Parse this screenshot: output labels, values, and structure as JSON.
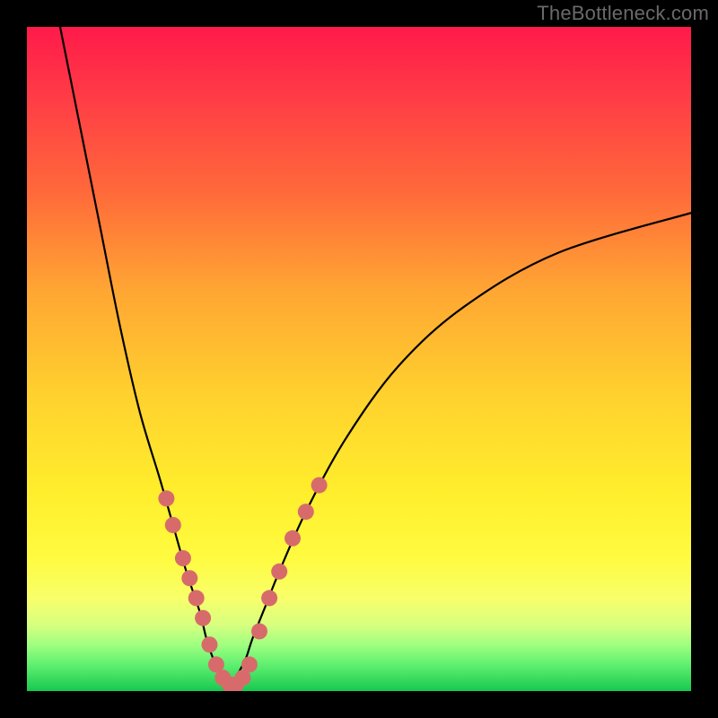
{
  "watermark": {
    "text": "TheBottleneck.com"
  },
  "chart_data": {
    "type": "line",
    "title": "",
    "xlabel": "",
    "ylabel": "",
    "xlim": [
      0,
      100
    ],
    "ylim": [
      0,
      100
    ],
    "grid": false,
    "legend": false,
    "series": [
      {
        "name": "bottleneck-curve",
        "x": [
          5,
          8,
          11,
          14,
          17,
          20,
          22,
          24,
          26,
          27,
          28,
          29,
          30,
          31,
          32,
          33,
          34,
          36,
          38,
          42,
          48,
          56,
          66,
          80,
          100
        ],
        "y": [
          100,
          85,
          70,
          55,
          42,
          32,
          25,
          18,
          12,
          8,
          5,
          3,
          1,
          1,
          3,
          5,
          8,
          13,
          18,
          27,
          38,
          49,
          58,
          66,
          72
        ]
      }
    ],
    "markers": {
      "name": "sample-dots",
      "color": "#d76b6b",
      "radius": 9,
      "points": [
        {
          "x": 21,
          "y": 29
        },
        {
          "x": 22,
          "y": 25
        },
        {
          "x": 23.5,
          "y": 20
        },
        {
          "x": 24.5,
          "y": 17
        },
        {
          "x": 25.5,
          "y": 14
        },
        {
          "x": 26.5,
          "y": 11
        },
        {
          "x": 27.5,
          "y": 7
        },
        {
          "x": 28.5,
          "y": 4
        },
        {
          "x": 29.5,
          "y": 2
        },
        {
          "x": 30.5,
          "y": 1
        },
        {
          "x": 31.5,
          "y": 1
        },
        {
          "x": 32.5,
          "y": 2
        },
        {
          "x": 33.5,
          "y": 4
        },
        {
          "x": 35,
          "y": 9
        },
        {
          "x": 36.5,
          "y": 14
        },
        {
          "x": 38,
          "y": 18
        },
        {
          "x": 40,
          "y": 23
        },
        {
          "x": 42,
          "y": 27
        },
        {
          "x": 44,
          "y": 31
        }
      ]
    }
  }
}
